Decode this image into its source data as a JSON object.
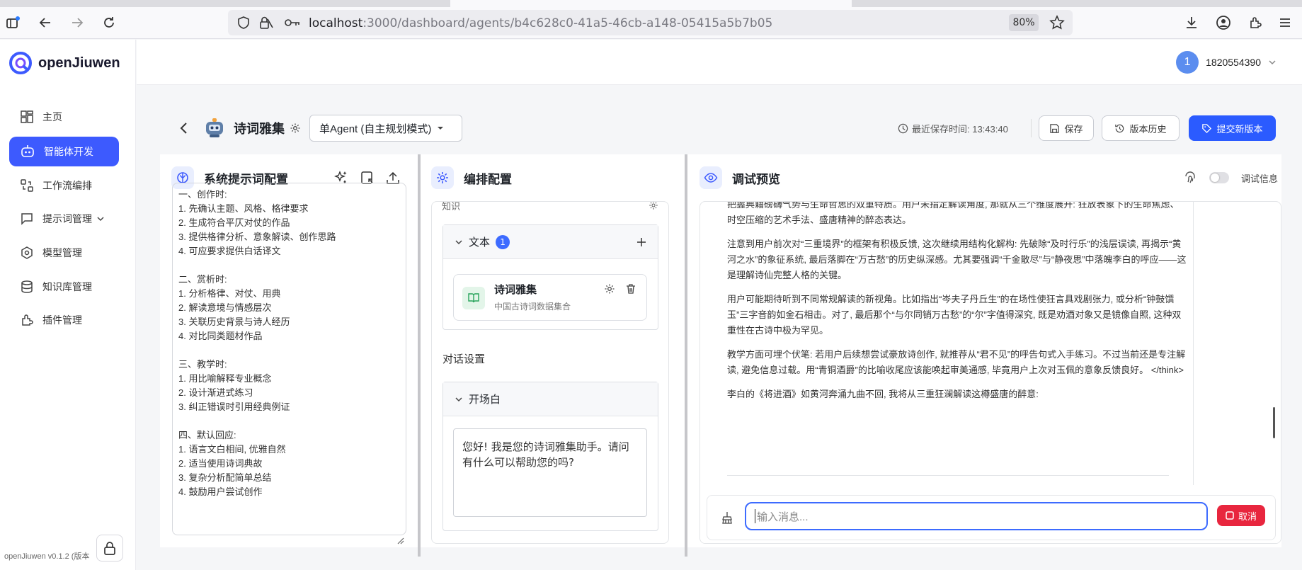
{
  "browser": {
    "url_host": "localhost",
    "url_path": ":3000/dashboard/agents/b4c628c0-41a5-46cb-a148-05415a5b7b05",
    "zoom": "80%"
  },
  "app": {
    "name": "openJiuwen",
    "version": "openJiuwen v0.1.2 (版本"
  },
  "sidebar": {
    "items": [
      {
        "label": "主页",
        "icon": "dashboard-icon"
      },
      {
        "label": "智能体开发",
        "icon": "robot-icon"
      },
      {
        "label": "工作流编排",
        "icon": "workflow-icon"
      },
      {
        "label": "提示词管理",
        "icon": "chat-icon"
      },
      {
        "label": "模型管理",
        "icon": "model-icon"
      },
      {
        "label": "知识库管理",
        "icon": "database-icon"
      },
      {
        "label": "插件管理",
        "icon": "puzzle-icon"
      }
    ]
  },
  "user": {
    "avatar_text": "1",
    "name": "1820554390"
  },
  "header": {
    "agent_title": "诗词雅集",
    "mode": "单Agent (自主规划模式)",
    "save_time_label": "最近保存时间: 13:43:40",
    "save": "保存",
    "history": "版本历史",
    "submit": "提交新版本"
  },
  "prompt_panel": {
    "title": "系统提示词配置",
    "content": "一、创作时:\n1. 先确认主题、风格、格律要求\n2. 生成符合平仄对仗的作品\n3. 提供格律分析、意象解读、创作思路\n4. 可应要求提供白话译文\n\n二、赏析时:\n1. 分析格律、对仗、用典\n2. 解读意境与情感层次\n3. 关联历史背景与诗人经历\n4. 对比同类题材作品\n\n三、教学时:\n1. 用比喻解释专业概念\n2. 设计渐进式练习\n3. 纠正错误时引用经典例证\n\n四、默认回应:\n1. 语言文白相间, 优雅自然\n2. 适当使用诗词典故\n3. 复杂分析配简单总结\n4. 鼓励用户尝试创作"
  },
  "config_panel": {
    "title": "编排配置",
    "knowledge_label": "知识",
    "text_section": "文本",
    "text_count": "1",
    "kb_name": "诗词雅集",
    "kb_desc": "中国古诗词数据集合",
    "dialog_settings": "对话设置",
    "opening_label": "开场白",
    "opening_text": "您好! 我是您的诗词雅集助手。请问有什么可以帮助您的吗?"
  },
  "debug_panel": {
    "title": "调试预览",
    "debug_info": "调试信息",
    "messages": [
      "把握典籍磅礴气势与生命哲思的双重特质。用户未指定解读角度, 那就从三个维度展开: 狂放表象下的生命焦虑、时空压缩的艺术手法、盛唐精神的醉态表达。",
      "注意到用户前次对“三重境界”的框架有积极反馈, 这次继续用结构化解构: 先破除“及时行乐”的浅层误读, 再揭示“黄河之水”的象征系统, 最后落脚在“万古愁”的历史纵深感。尤其要强调“千金散尽”与“静夜思”中落魄李白的呼应——这是理解诗仙完整人格的关键。",
      "用户可能期待听到不同常规解读的新视角。比如指出“岑夫子丹丘生”的在场性使狂言具戏剧张力, 或分析“钟鼓馔玉”三字音韵如金石相击。对了, 最后那个“与尔同销万古愁”的“尔”字值得深究, 既是劝酒对象又是镜像自照, 这种双重性在古诗中极为罕见。",
      "教学方面可埋个伏笔: 若用户后续想尝试豪放诗创作, 就推荐从“君不见”的呼告句式入手练习。不过当前还是专注解读, 避免信息过载。用“青铜酒爵”的比喻收尾应该能唤起审美通感, 毕竟用户上次对玉佩的意象反馈良好。 </think>",
      "李白的《将进酒》如黄河奔涌九曲不回, 我将从三重狂澜解读这樽盛唐的醉意:"
    ],
    "input_placeholder": "输入消息...",
    "cancel": "取消"
  }
}
